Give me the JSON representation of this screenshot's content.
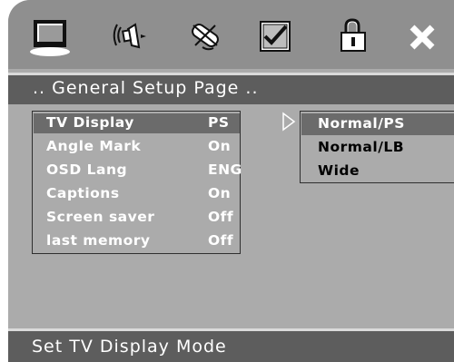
{
  "toolbar": {
    "icons": [
      "tv-icon",
      "speaker-icon",
      "satellite-icon",
      "checkbox-icon",
      "lock-icon",
      "close-icon"
    ],
    "selected": "tv-icon"
  },
  "header": {
    "title": ".. General Setup Page .."
  },
  "menu": {
    "items": [
      {
        "label": "TV Display",
        "value": "PS",
        "selected": true
      },
      {
        "label": "Angle Mark",
        "value": "On"
      },
      {
        "label": "OSD Lang",
        "value": "ENG"
      },
      {
        "label": "Captions",
        "value": "On"
      },
      {
        "label": "Screen saver",
        "value": "Off"
      },
      {
        "label": "last memory",
        "value": "Off"
      }
    ]
  },
  "submenu": {
    "options": [
      {
        "label": "Normal/PS",
        "selected": true
      },
      {
        "label": "Normal/LB"
      },
      {
        "label": "Wide"
      }
    ]
  },
  "footer": {
    "hint": "Set TV Display Mode"
  },
  "colors": {
    "panel": "#ababab",
    "topbar": "#8f8f8f",
    "header": "#5d5d5d",
    "highlight": "#6b6b6b",
    "text_light": "#ffffff",
    "text_dark": "#000000"
  }
}
